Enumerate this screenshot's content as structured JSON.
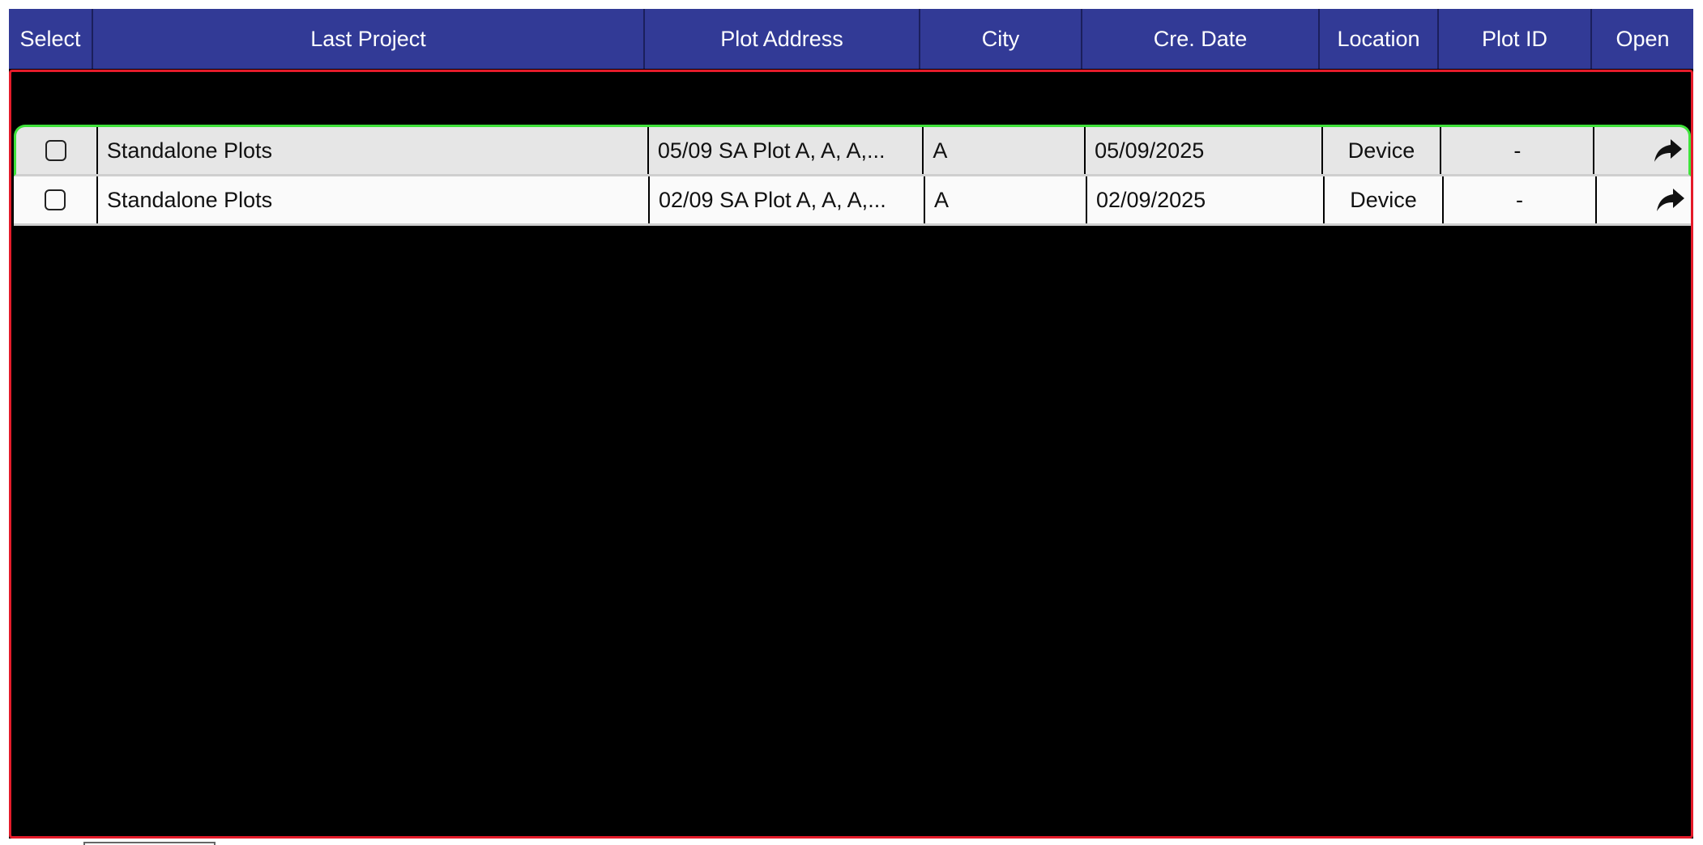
{
  "table": {
    "columns": [
      {
        "key": "select",
        "label": "Select"
      },
      {
        "key": "last_project",
        "label": "Last Project"
      },
      {
        "key": "plot_address",
        "label": "Plot Address"
      },
      {
        "key": "city",
        "label": "City"
      },
      {
        "key": "cre_date",
        "label": "Cre. Date"
      },
      {
        "key": "location",
        "label": "Location"
      },
      {
        "key": "plot_id",
        "label": "Plot ID"
      },
      {
        "key": "open",
        "label": "Open"
      }
    ],
    "rows": [
      {
        "selected": false,
        "last_project": "Standalone Plots",
        "plot_address": "05/09 SA Plot A, A, A,...",
        "city": "A",
        "cre_date": "05/09/2025",
        "location": "Device",
        "plot_id": "-",
        "open_icon": "share-arrow-icon",
        "highlighted": true
      },
      {
        "selected": false,
        "last_project": "Standalone Plots",
        "plot_address": "02/09 SA Plot A, A, A,...",
        "city": "A",
        "cre_date": "02/09/2025",
        "location": "Device",
        "plot_id": "-",
        "open_icon": "share-arrow-icon",
        "highlighted": false
      }
    ]
  },
  "colors": {
    "header_bg": "#323a96",
    "highlight_border": "#3fe23a",
    "body_border": "#e41b2a",
    "row_bg_1": "#e6e6e6",
    "row_bg_2": "#fafafa"
  }
}
